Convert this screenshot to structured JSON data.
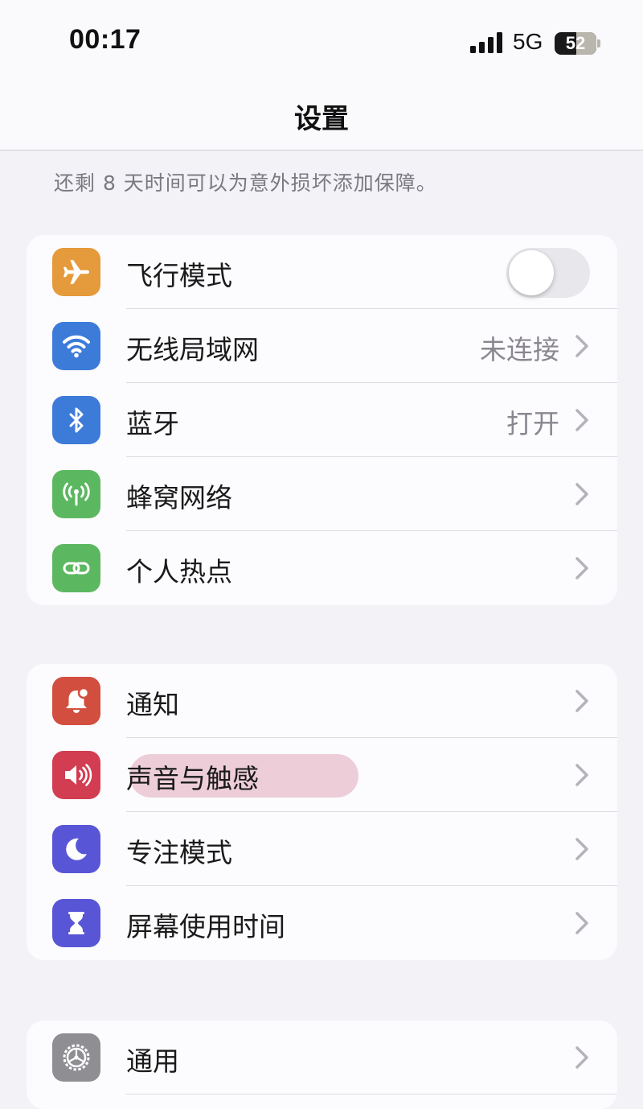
{
  "status_bar": {
    "time": "00:17",
    "network": "5G",
    "battery": "52",
    "battery_level": 0.52,
    "signal_bars": 4
  },
  "nav": {
    "title": "设置"
  },
  "note": "还剩 8 天时间可以为意外损坏添加保障。",
  "groups": [
    {
      "rows": [
        {
          "label": "飞行模式",
          "icon": "airplane-icon",
          "color": "#e59a3b",
          "toggle": false
        },
        {
          "label": "无线局域网",
          "value": "未连接",
          "icon": "wifi-icon",
          "color": "#3d7bd9"
        },
        {
          "label": "蓝牙",
          "value": "打开",
          "icon": "bluetooth-icon",
          "color": "#3d7bd9"
        },
        {
          "label": "蜂窝网络",
          "icon": "cellular-icon",
          "color": "#5cb860"
        },
        {
          "label": "个人热点",
          "icon": "hotspot-icon",
          "color": "#5cb860"
        }
      ]
    },
    {
      "rows": [
        {
          "label": "通知",
          "icon": "notification-bell-icon",
          "color": "#d24e3f"
        },
        {
          "label": "声音与触感",
          "icon": "speaker-icon",
          "color": "#d23d52",
          "highlighted": true
        },
        {
          "label": "专注模式",
          "icon": "moon-icon",
          "color": "#5856d6"
        },
        {
          "label": "屏幕使用时间",
          "icon": "hourglass-icon",
          "color": "#5856d6"
        }
      ]
    },
    {
      "rows": [
        {
          "label": "通用",
          "icon": "gear-icon",
          "color": "#8e8e93"
        }
      ]
    }
  ]
}
